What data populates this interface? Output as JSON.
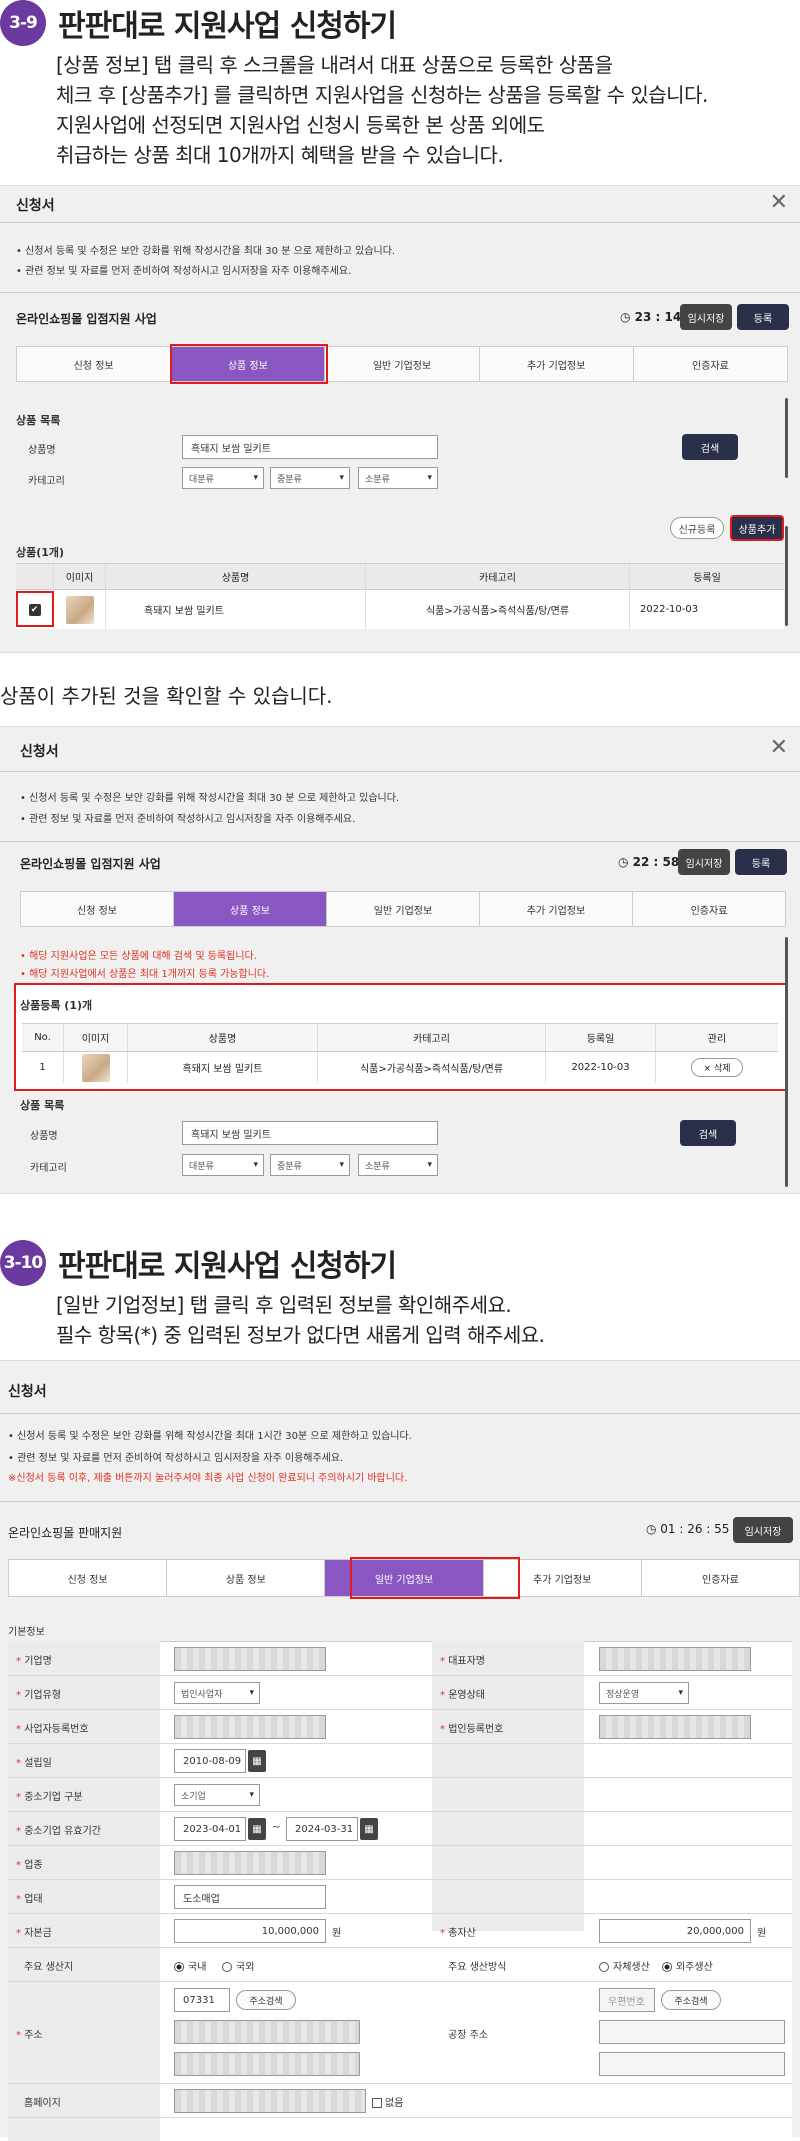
{
  "s1": {
    "badge": "3-9",
    "title": "판판대로 지원사업 신청하기",
    "lines": [
      "[상품 정보] 탭 클릭 후 스크롤을 내려서 대표 상품으로 등록한 상품을",
      "체크 후 [상품추가] 를 클릭하면 지원사업을 신청하는 상품을 등록할 수 있습니다.",
      "지원사업에 선정되면 지원사업 신청시 등록한 본 상품 외에도",
      "취급하는 상품 최대 10개까지 혜택을 받을 수 있습니다."
    ]
  },
  "p1": {
    "title": "신청서",
    "notices": [
      "• 신청서 등록 및 수정은 보안 강화를 위해 작성시간을 최대 30 분 으로 제한하고 있습니다.",
      "• 관련 정보 및 자료를 먼저 준비하여 작성하시고 임시저장을 자주 이용해주세요."
    ],
    "program": "온라인쇼핑몰 입점지원 사업",
    "timer": "◷ 23 : 14",
    "save_btn": "임시저장",
    "register_btn": "등록",
    "tabs": [
      "신청 정보",
      "상품 정보",
      "일반 기업정보",
      "추가 기업정보",
      "인증자료"
    ],
    "list_title": "상품 목록",
    "name_label": "상품명",
    "name_value": "흑돼지 보쌈 밀키트",
    "search_btn": "검색",
    "cat_label": "카테고리",
    "cats": [
      "대분류",
      "중분류",
      "소분류"
    ],
    "new_btn": "신규등록",
    "add_btn": "상품추가",
    "count": "상품(1개)",
    "cols": [
      "",
      "이미지",
      "상품명",
      "카테고리",
      "등록일"
    ],
    "row": {
      "name": "흑돼지 보쌈 밀키트",
      "category": "식품>가공식품>즉석식품/탕/면류",
      "date": "2022-10-03"
    }
  },
  "mid_text": "상품이 추가된 것을 확인할 수 있습니다.",
  "p2": {
    "title": "신청서",
    "notices": [
      "• 신청서 등록 및 수정은 보안 강화를 위해 작성시간을 최대 30 분 으로 제한하고 있습니다.",
      "• 관련 정보 및 자료를 먼저 준비하여 작성하시고 임시저장을 자주 이용해주세요."
    ],
    "program": "온라인쇼핑몰 입점지원 사업",
    "timer": "◷ 22 : 58",
    "save_btn": "임시저장",
    "register_btn": "등록",
    "tabs": [
      "신청 정보",
      "상품 정보",
      "일반 기업정보",
      "추가 기업정보",
      "인증자료"
    ],
    "warn1": "• 해당 지원사업은 모든 상품에 대해 검색 및 등록됩니다.",
    "warn2": "• 해당 지원사업에서 상품은 최대 1개까지 등록 가능합니다.",
    "reg_title": "상품등록 (1)개",
    "cols": [
      "No.",
      "이미지",
      "상품명",
      "카테고리",
      "등록일",
      "관리"
    ],
    "row": {
      "no": "1",
      "name": "흑돼지 보쌈 밀키트",
      "category": "식품>가공식품>즉석식품/탕/면류",
      "date": "2022-10-03",
      "delete": "× 삭제"
    },
    "list_title": "상품 목록",
    "name_label": "상품명",
    "name_value": "흑돼지 보쌈 밀키트",
    "search_btn": "검색",
    "cat_label": "카테고리",
    "cats": [
      "대분류",
      "중분류",
      "소분류"
    ]
  },
  "s2": {
    "badge": "3-10",
    "title": "판판대로 지원사업 신청하기",
    "lines": [
      "[일반 기업정보] 탭 클릭 후 입력된 정보를 확인해주세요.",
      "필수 항목(*) 중 입력된 정보가 없다면 새롭게 입력 해주세요."
    ]
  },
  "p3": {
    "title": "신청서",
    "notices": [
      "• 신청서 등록 및 수정은 보안 강화를 위해 작성시간을 최대 1시간 30분 으로 제한하고 있습니다.",
      "• 관련 정보 및 자료를 먼저 준비하여 작성하시고 임시저장을 자주 이용해주세요."
    ],
    "notice_red": "※신청서 등록 이후, 제출 버튼까지 눌러주셔야 최종 사업 신청이 완료되니 주의하시기 바랍니다.",
    "program": "온라인쇼핑몰 판매지원",
    "timer": "◷ 01 : 26 : 55",
    "save_btn": "임시저장",
    "tabs": [
      "신청 정보",
      "상품 정보",
      "일반 기업정보",
      "추가 기업정보",
      "인증자료"
    ],
    "basic": "기본정보",
    "f": {
      "company": "기업명",
      "ceo": "대표자명",
      "ctype": "기업유형",
      "ctype_v": "법인사업자",
      "status": "운영상태",
      "status_v": "정상운영",
      "bizno": "사업자등록번호",
      "corpno": "법인등록번호",
      "founded": "설립일",
      "founded_v": "2010-08-09",
      "sme": "중소기업 구분",
      "sme_v": "소기업",
      "sme_period": "중소기업 유효기간",
      "from": "2023-04-01",
      "tilde": "~",
      "to": "2024-03-31",
      "industry": "업종",
      "sector": "업태",
      "sector_v": "도소매업",
      "capital": "자본금",
      "capital_v": "10,000,000",
      "won": "원",
      "assets": "총자산",
      "assets_v": "20,000,000",
      "prod_area": "주요 생산지",
      "domestic": "국내",
      "overseas": "국외",
      "prod_method": "주요 생산방식",
      "self": "자체생산",
      "outsourced": "외주생산",
      "addr": "주소",
      "zip": "07331",
      "zip_btn": "주소검색",
      "factory": "공장 주소",
      "factory_zip": "우편번호",
      "homepage": "홈페이지",
      "none": "없음"
    }
  }
}
